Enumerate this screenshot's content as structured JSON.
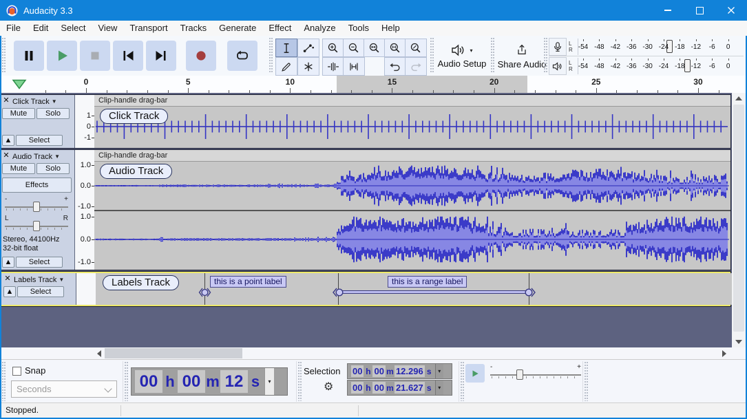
{
  "window": {
    "title": "Audacity 3.3"
  },
  "menu": [
    "File",
    "Edit",
    "Select",
    "View",
    "Transport",
    "Tracks",
    "Generate",
    "Effect",
    "Analyze",
    "Tools",
    "Help"
  ],
  "transport": {
    "pause": "Pause",
    "play": "Play",
    "stop": "Stop",
    "skip_start": "Skip to Start",
    "skip_end": "Skip to End",
    "record": "Record",
    "loop": "Loop"
  },
  "tools": {
    "selection": "Selection Tool",
    "envelope": "Envelope Tool",
    "draw": "Draw Tool",
    "multi": "Multi-Tool"
  },
  "edit_toolbar": {
    "zoom_in": "Zoom In",
    "zoom_out": "Zoom Out",
    "fit_selection": "Fit Selection to Width",
    "fit_project": "Fit Project to Width",
    "zoom_toggle": "Zoom Toggle",
    "trim": "Trim Audio",
    "silence": "Silence Audio",
    "undo": "Undo",
    "redo": "Redo"
  },
  "device": {
    "audio_setup": "Audio Setup",
    "share_audio": "Share Audio"
  },
  "meters": {
    "channels": [
      "L",
      "R"
    ],
    "scale": [
      "-54",
      "-48",
      "-42",
      "-36",
      "-30",
      "-24",
      "-18",
      "-12",
      "-6",
      "0"
    ]
  },
  "ruler": {
    "ticks": [
      "0",
      "5",
      "10",
      "15",
      "20",
      "25",
      "30"
    ],
    "selection_start_s": 12.296,
    "selection_end_s": 21.627
  },
  "tracks": [
    {
      "name": "Click Track",
      "clip_title": "Clip-handle drag-bar",
      "scale": [
        "1",
        "0",
        "-1"
      ],
      "mute": "Mute",
      "solo": "Solo",
      "select": "Select"
    },
    {
      "name": "Audio Track",
      "clip_title": "Clip-handle drag-bar",
      "scale": [
        "1.0",
        "0.0",
        "-1.0"
      ],
      "mute": "Mute",
      "solo": "Solo",
      "effects": "Effects",
      "select": "Select",
      "info": [
        "Stereo, 44100Hz",
        "32-bit float"
      ],
      "gain_min": "-",
      "gain_max": "+",
      "pan_left": "L",
      "pan_right": "R"
    },
    {
      "name": "Labels Track",
      "select": "Select",
      "labels": [
        {
          "type": "point",
          "text": "this is a point label",
          "time_s": 5.74
        },
        {
          "type": "range",
          "text": "this is a range label",
          "start_s": 12.296,
          "end_s": 21.627
        }
      ]
    }
  ],
  "bottom": {
    "snap": "Snap",
    "snap_checked": false,
    "units": "Seconds",
    "position_cells": [
      {
        "v": "00",
        "t": "digit"
      },
      {
        "v": "h",
        "t": "unit"
      },
      {
        "v": "00",
        "t": "digit"
      },
      {
        "v": "m",
        "t": "unit"
      },
      {
        "v": "12",
        "t": "digit"
      },
      {
        "v": "s",
        "t": "unit"
      }
    ],
    "selection_label": "Selection",
    "sel_start_cells": [
      {
        "v": "00",
        "t": "digit"
      },
      {
        "v": "h",
        "t": "unit"
      },
      {
        "v": "00",
        "t": "digit"
      },
      {
        "v": "m",
        "t": "unit"
      },
      {
        "v": "12.296",
        "t": "digit"
      },
      {
        "v": "s",
        "t": "unit"
      }
    ],
    "sel_end_cells": [
      {
        "v": "00",
        "t": "digit"
      },
      {
        "v": "h",
        "t": "unit"
      },
      {
        "v": "00",
        "t": "digit"
      },
      {
        "v": "m",
        "t": "unit"
      },
      {
        "v": "21.627",
        "t": "digit"
      },
      {
        "v": "s",
        "t": "unit"
      }
    ],
    "speed_min": "-",
    "speed_max": "+"
  },
  "status": {
    "text": "Stopped."
  },
  "colors": {
    "titlebar": "#1182d9",
    "button_face": "#ccd9f1",
    "wave_outer": "#3b3bc8",
    "wave_inner": "#8787e4",
    "wave_center": "#2a2ab8",
    "selection_ruler": "#c9c9c9",
    "labels_border": "#eeea6a",
    "digit_blue": "#2525b2"
  }
}
